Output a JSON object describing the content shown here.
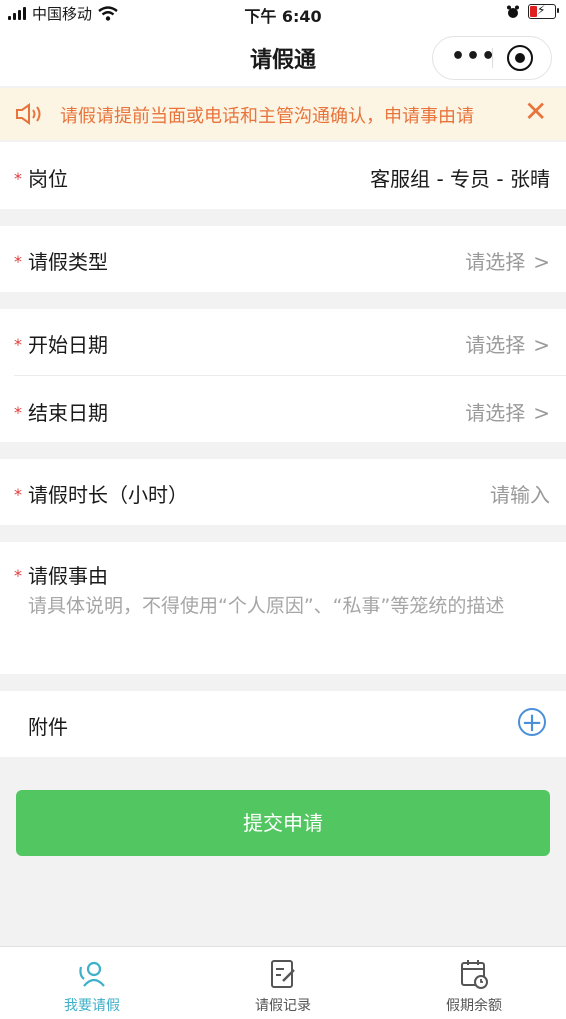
{
  "status_bar": {
    "carrier": "中国移动",
    "time": "下午 6:40"
  },
  "nav": {
    "title": "请假通"
  },
  "notice": {
    "text": "请假请提前当面或电话和主管沟通确认，申请事由请",
    "close_icon": "close-icon"
  },
  "form": {
    "position": {
      "label": "岗位",
      "value": "客服组 - 专员 - 张晴"
    },
    "leave_type": {
      "label": "请假类型",
      "value": "请选择"
    },
    "start_date": {
      "label": "开始日期",
      "value": "请选择"
    },
    "end_date": {
      "label": "结束日期",
      "value": "请选择"
    },
    "duration": {
      "label": "请假时长（小时）",
      "placeholder": "请输入"
    },
    "reason": {
      "label": "请假事由",
      "placeholder": "请具体说明，不得使用“个人原因”、“私事”等笼统的描述"
    },
    "attachment": {
      "label": "附件"
    },
    "required_mark": "*"
  },
  "submit": {
    "label": "提交申请"
  },
  "tabs": [
    {
      "label": "我要请假",
      "icon": "person-search-icon",
      "active": true
    },
    {
      "label": "请假记录",
      "icon": "edit-document-icon",
      "active": false
    },
    {
      "label": "假期余额",
      "icon": "calendar-clock-icon",
      "active": false
    }
  ],
  "colors": {
    "accent": "#52c661",
    "notice": "#e8743c",
    "tab_active": "#3fb0c9",
    "required": "#e23b3b",
    "plus": "#4a90d9"
  }
}
